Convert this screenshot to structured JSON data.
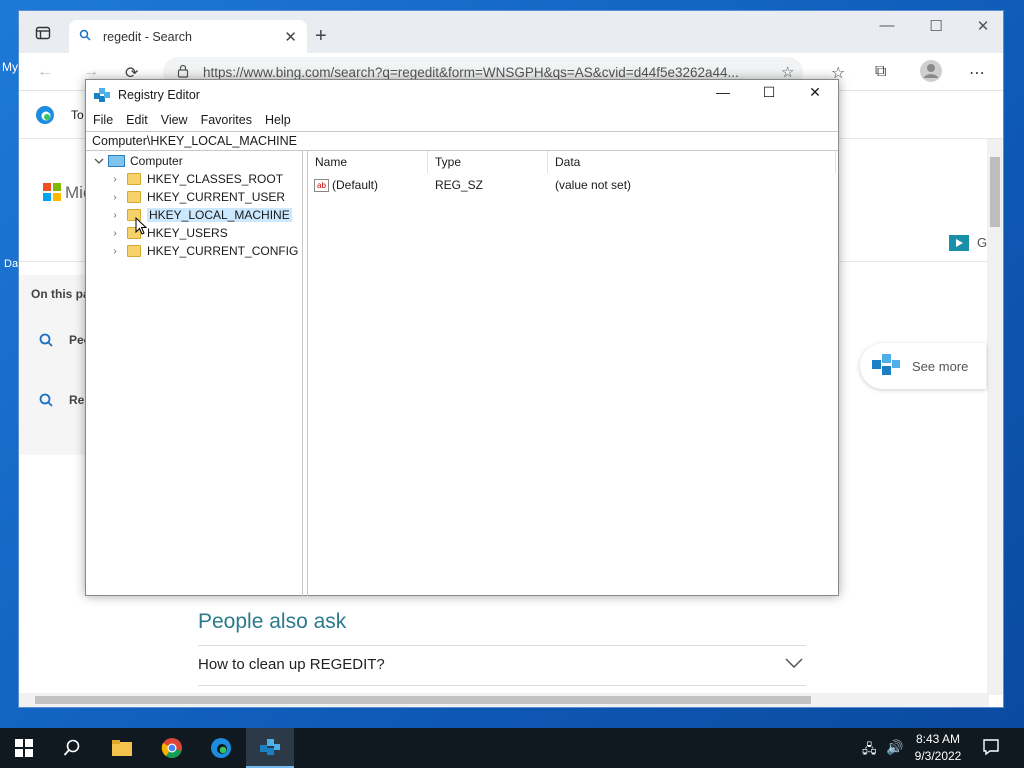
{
  "desktop": {
    "icon_label_1": "My",
    "icon_label_2": "Da"
  },
  "browser": {
    "tab_title": "regedit - Search",
    "address": "https://www.bing.com/search?q=regedit&form=WNSGPH&qs=AS&cvid=d44f5e3262a44...",
    "fav_text": "To",
    "brand_text": "Mic",
    "on_this_page": "On this pa",
    "side_item_1": "Peo",
    "side_item_2": "Rel",
    "g_text": "G",
    "see_more": "See more",
    "people_also_ask": "People also ask",
    "question_1": "How to clean up REGEDIT?"
  },
  "regedit": {
    "title": "Registry Editor",
    "menu": [
      "File",
      "Edit",
      "View",
      "Favorites",
      "Help"
    ],
    "path": "Computer\\HKEY_LOCAL_MACHINE",
    "tree_root": "Computer",
    "tree_items": [
      "HKEY_CLASSES_ROOT",
      "HKEY_CURRENT_USER",
      "HKEY_LOCAL_MACHINE",
      "HKEY_USERS",
      "HKEY_CURRENT_CONFIG"
    ],
    "columns": [
      "Name",
      "Type",
      "Data"
    ],
    "rows": [
      {
        "name": "(Default)",
        "type": "REG_SZ",
        "data": "(value not set)"
      }
    ]
  },
  "taskbar": {
    "time": "8:43 AM",
    "date": "9/3/2022"
  }
}
